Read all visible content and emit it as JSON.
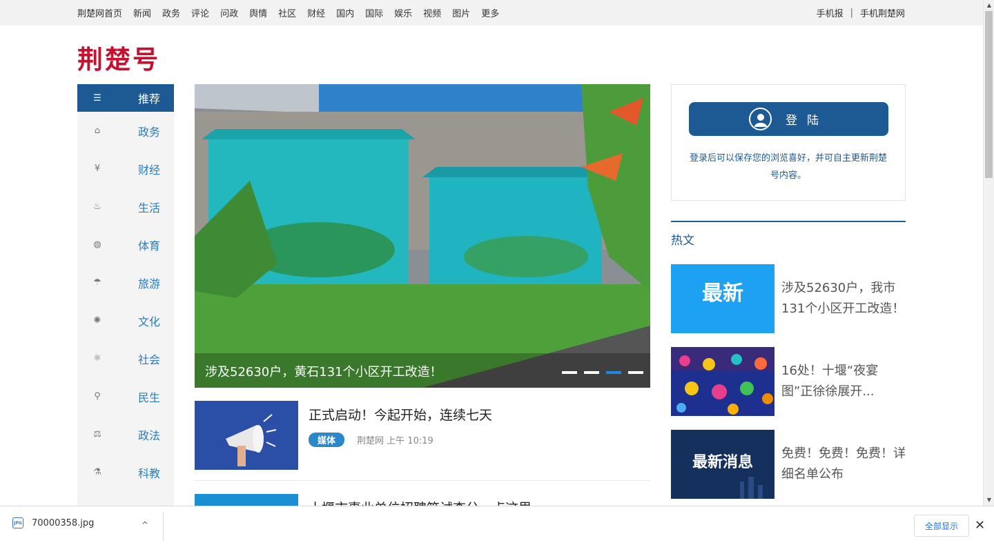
{
  "topnav": {
    "items": [
      "荆楚网首页",
      "新闻",
      "政务",
      "评论",
      "问政",
      "舆情",
      "社区",
      "财经",
      "国内",
      "国际",
      "娱乐",
      "视频",
      "图片",
      "更多"
    ],
    "right": [
      "手机报",
      "手机荆楚网"
    ],
    "separator": "|"
  },
  "logo": "荆楚号",
  "sidebar": {
    "items": [
      {
        "label": "推荐",
        "icon": "recommend-icon",
        "glyph": "☰"
      },
      {
        "label": "政务",
        "icon": "government-building-icon",
        "glyph": "⌂"
      },
      {
        "label": "财经",
        "icon": "yen-coin-icon",
        "glyph": "¥"
      },
      {
        "label": "生活",
        "icon": "life-icon",
        "glyph": "♨"
      },
      {
        "label": "体育",
        "icon": "ball-icon",
        "glyph": "◍"
      },
      {
        "label": "旅游",
        "icon": "umbrella-icon",
        "glyph": "☂"
      },
      {
        "label": "文化",
        "icon": "film-reel-icon",
        "glyph": "✺"
      },
      {
        "label": "社会",
        "icon": "atom-icon",
        "glyph": "⚛"
      },
      {
        "label": "民生",
        "icon": "location-pin-icon",
        "glyph": "⚲"
      },
      {
        "label": "政法",
        "icon": "scales-icon",
        "glyph": "⚖"
      },
      {
        "label": "科教",
        "icon": "science-icon",
        "glyph": "⚗"
      }
    ]
  },
  "slider": {
    "caption": "涉及52630户，黄石131个小区开工改造！",
    "slide_count": 4,
    "active_index": 2
  },
  "news": [
    {
      "title": "正式启动！今起开始，连续七天",
      "tag": "媒体",
      "source": "荆楚网",
      "time": "上午 10:19"
    },
    {
      "title": "十堰市事业单位招聘笔试查分，点这里→"
    }
  ],
  "login": {
    "button_label": "登陆",
    "tip": "登录后可以保存您的浏览喜好，并可自主更新荆楚号内容。"
  },
  "hot": {
    "heading": "热文",
    "items": [
      {
        "title": "涉及52630户，我市131个小区开工改造！",
        "thumb_text": "最新"
      },
      {
        "title": "16处！十堰“夜宴图”正徐徐展开..."
      },
      {
        "title": "免费！免费！免费！详细名单公布",
        "thumb_text": "最新消息"
      }
    ]
  },
  "download_bar": {
    "filename": "70000358.jpg",
    "file_icon_text": "JPG",
    "show_all": "全部显示",
    "close": "✕",
    "chevron": "^"
  },
  "colors": {
    "brand_red": "#c8102e",
    "primary_blue": "#1d5a94",
    "link_blue": "#2a7bbf",
    "active_dot": "#1e88e5"
  }
}
